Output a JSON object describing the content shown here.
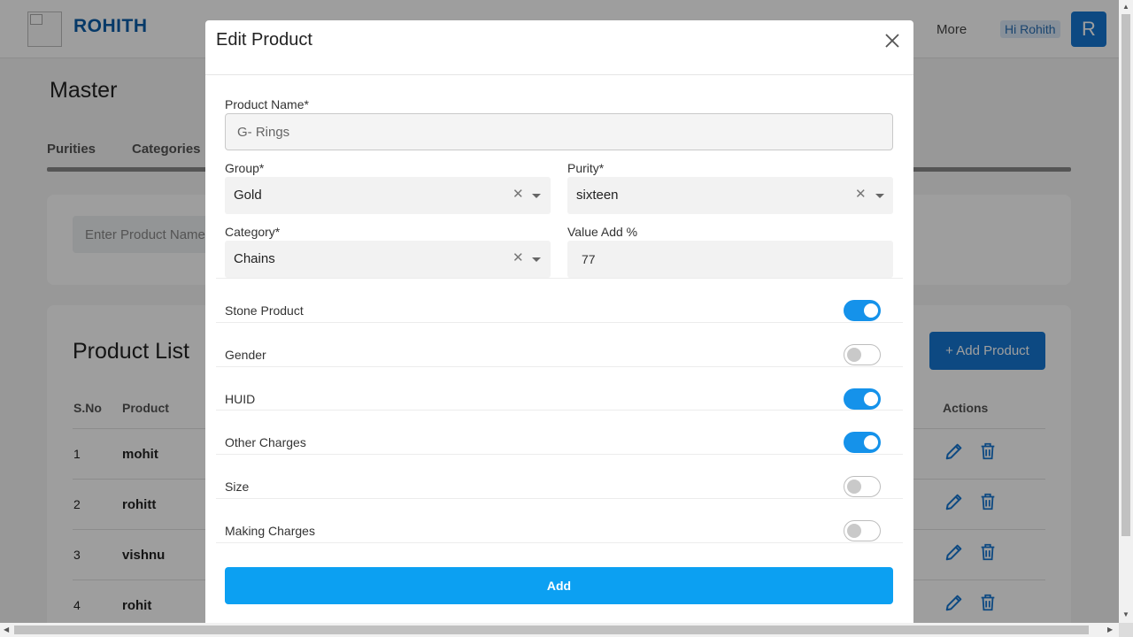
{
  "header": {
    "brand": "ROHITH",
    "nav_more": "More",
    "greeting": "Hi Rohith",
    "avatar_letter": "R"
  },
  "page": {
    "title": "Master",
    "tabs": [
      {
        "label": "Purities"
      },
      {
        "label": "Categories"
      }
    ],
    "filter_placeholder": "Enter Product Name"
  },
  "product_list": {
    "title": "Product List",
    "add_button": "+ Add Product",
    "columns": [
      "S.No",
      "Product",
      "Actions"
    ],
    "rows": [
      {
        "sno": "1",
        "product": "mohit"
      },
      {
        "sno": "2",
        "product": "rohitt"
      },
      {
        "sno": "3",
        "product": "vishnu"
      },
      {
        "sno": "4",
        "product": "rohit"
      }
    ]
  },
  "modal": {
    "title": "Edit Product",
    "product_name_label": "Product Name*",
    "product_name_value": "G- Rings",
    "group_label": "Group*",
    "group_value": "Gold",
    "purity_label": "Purity*",
    "purity_value": "sixteen",
    "category_label": "Category*",
    "category_value": "Chains",
    "value_add_label": "Value Add %",
    "value_add_value": "77",
    "toggles": [
      {
        "label": "Stone Product",
        "on": true
      },
      {
        "label": "Gender",
        "on": false
      },
      {
        "label": "HUID",
        "on": true
      },
      {
        "label": "Other Charges",
        "on": true
      },
      {
        "label": "Size",
        "on": false
      },
      {
        "label": "Making Charges",
        "on": false
      }
    ],
    "submit_label": "Add"
  },
  "colors": {
    "primary": "#1677d2",
    "submit": "#0ca0f2",
    "toggle_on": "#1592ea",
    "brand_text": "#0a5da8"
  },
  "icons": {
    "close": "close-icon",
    "edit": "pencil-icon",
    "delete": "trash-icon",
    "clear": "clear-icon",
    "dropdown": "chevron-down-icon"
  }
}
